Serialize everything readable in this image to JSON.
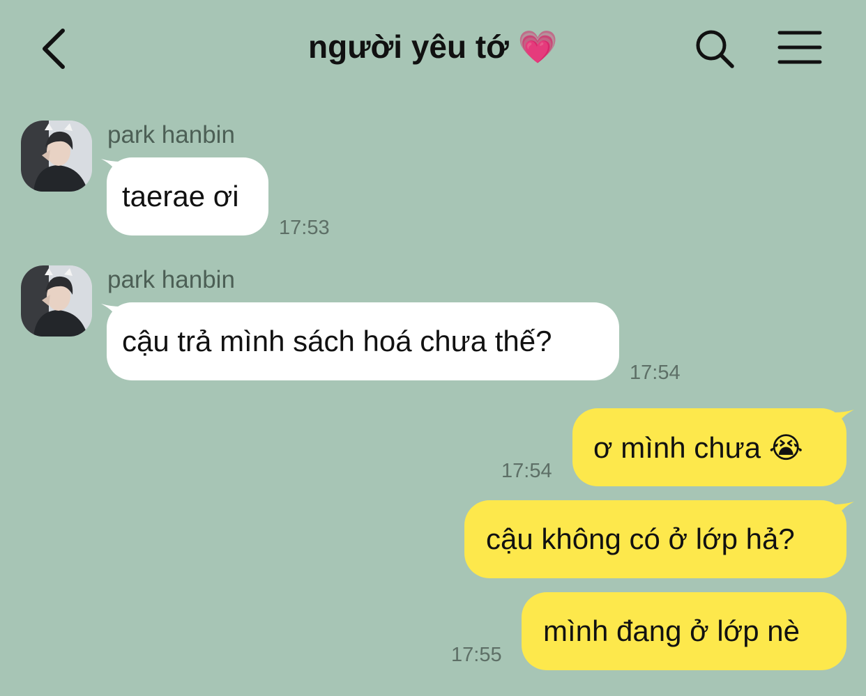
{
  "header": {
    "title": "người yêu tớ 💗",
    "back_icon": "chevron-left-icon",
    "search_icon": "search-icon",
    "menu_icon": "hamburger-menu-icon"
  },
  "colors": {
    "background": "#a7c5b5",
    "incoming_bubble": "#ffffff",
    "outgoing_bubble": "#fde84c",
    "timestamp": "#5d6f66"
  },
  "messages": [
    {
      "direction": "incoming",
      "sender": "park hanbin",
      "text": "taerae ơi",
      "time": "17:53"
    },
    {
      "direction": "incoming",
      "sender": "park hanbin",
      "text": "cậu trả mình sách hoá chưa thế?",
      "time": "17:54"
    },
    {
      "direction": "outgoing",
      "text": "ơ mình chưa 😭",
      "time": "17:54"
    },
    {
      "direction": "outgoing",
      "text": "cậu không có ở lớp hả?",
      "time": ""
    },
    {
      "direction": "outgoing",
      "text": "mình đang ở lớp nè",
      "time": "17:55"
    }
  ]
}
